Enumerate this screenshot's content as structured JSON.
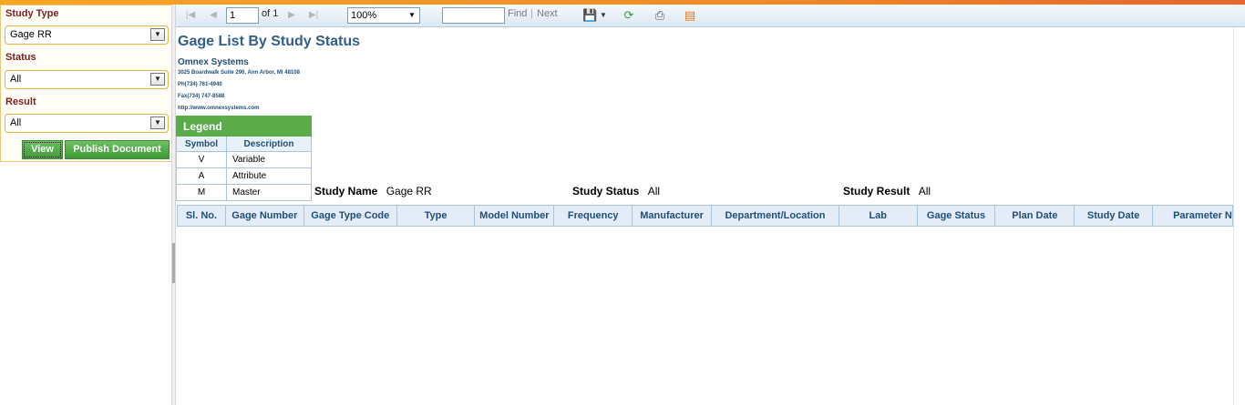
{
  "filters": {
    "study_type": {
      "label": "Study Type",
      "value": "Gage RR"
    },
    "status": {
      "label": "Status",
      "value": "All"
    },
    "result": {
      "label": "Result",
      "value": "All"
    },
    "view_label": "View",
    "publish_label": "Publish Document"
  },
  "toolbar": {
    "page_value": "1",
    "page_of": "of 1",
    "zoom_value": "100%",
    "find_label": "Find",
    "separator": "|",
    "next_label": "Next"
  },
  "report": {
    "title": "Gage List By Study Status",
    "company": "Omnex Systems",
    "address": "3025 Boardwalk Suite 290, Ann Arbor, MI 48108",
    "phone": "Ph(734) 761-4940",
    "fax": "Fax(734) 747-8588",
    "website": "http://www.omnexsystems.com",
    "legend": {
      "title": "Legend",
      "col_symbol": "Symbol",
      "col_description": "Description",
      "rows": [
        {
          "symbol": "V",
          "description": "Variable"
        },
        {
          "symbol": "A",
          "description": "Attribute"
        },
        {
          "symbol": "M",
          "description": "Master"
        }
      ]
    },
    "criteria": {
      "study_name_label": "Study Name",
      "study_name_value": "Gage RR",
      "study_status_label": "Study Status",
      "study_status_value": "All",
      "study_result_label": "Study Result",
      "study_result_value": "All"
    },
    "columns": [
      "Sl. No.",
      "Gage Number",
      "Gage Type Code",
      "Type",
      "Model Number",
      "Frequency",
      "Manufacturer",
      "Department/Location",
      "Lab",
      "Gage Status",
      "Plan Date",
      "Study Date",
      "Parameter N"
    ]
  },
  "colors": {
    "accent_orange": "#f08b2a",
    "button_green": "#4caf50",
    "title_blue": "#2f5f8a",
    "label_maroon": "#7a1f1f"
  }
}
